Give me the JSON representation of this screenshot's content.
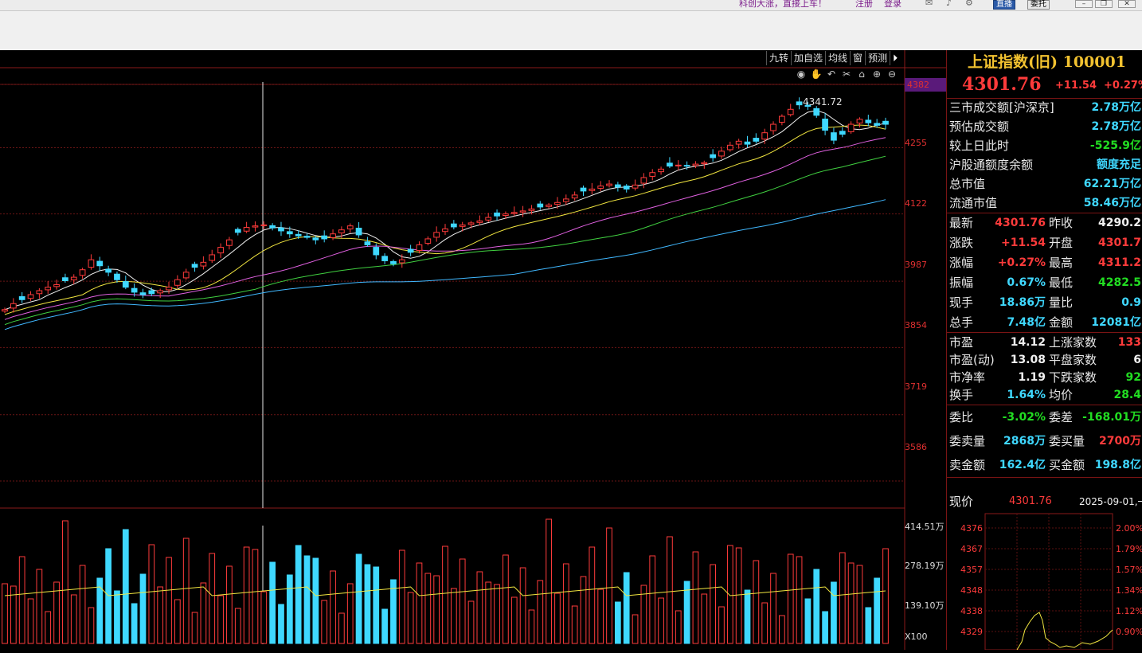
{
  "topbar": {
    "promo": "科创大涨，直接上车！",
    "register": "注册",
    "login": "登录",
    "icons": [
      "mail-icon",
      "bell-icon",
      "settings-icon"
    ],
    "btn_live": "直播",
    "btn_order": "委托"
  },
  "toolbar_buttons": [
    "九转",
    "加自选",
    "均线",
    "窗",
    "预测"
  ],
  "chart": {
    "price_axis": [
      "4382",
      "4255",
      "4122",
      "3987",
      "3854",
      "3719",
      "3586"
    ],
    "high_label": "4341.72",
    "volume_axis": [
      "414.51万",
      "278.19万",
      "139.10万"
    ],
    "volume_unit": "X100"
  },
  "chart_data": {
    "type": "candlestick",
    "price_axis_ticks": [
      4382,
      4255,
      4122,
      3987,
      3854,
      3719,
      3586
    ],
    "ylim": [
      3500,
      4400
    ],
    "high": 4341.72,
    "volume_axis_ticks_wan": [
      414.51,
      278.19,
      139.1
    ],
    "closes": [
      3930,
      3942,
      3950,
      3960,
      3968,
      3975,
      3980,
      3988,
      3995,
      4010,
      4030,
      4018,
      4005,
      3990,
      3975,
      3965,
      3960,
      3962,
      3968,
      3975,
      3990,
      4005,
      4015,
      4025,
      4040,
      4055,
      4070,
      4085,
      4095,
      4098,
      4100,
      4094,
      4088,
      4082,
      4078,
      4075,
      4070,
      4072,
      4082,
      4090,
      4098,
      4080,
      4060,
      4040,
      4028,
      4022,
      4030,
      4045,
      4060,
      4072,
      4085,
      4092,
      4096,
      4100,
      4104,
      4108,
      4115,
      4118,
      4122,
      4125,
      4128,
      4132,
      4136,
      4140,
      4145,
      4152,
      4160,
      4168,
      4172,
      4178,
      4182,
      4176,
      4172,
      4180,
      4195,
      4205,
      4212,
      4218,
      4220,
      4218,
      4222,
      4225,
      4235,
      4248,
      4260,
      4268,
      4262,
      4268,
      4285,
      4302,
      4318,
      4332,
      4341,
      4338,
      4320,
      4290,
      4270,
      4282,
      4302,
      4312,
      4305,
      4300,
      4302
    ]
  },
  "panel": {
    "title": "上证指数(旧) 100001",
    "price": "4301.76",
    "change": "+11.54",
    "pct": "+0.27%",
    "block1": [
      {
        "label": "三市成交额[沪深京]",
        "value": "2.78万亿",
        "color": "cyan"
      },
      {
        "label": "预估成交额",
        "value": "2.78万亿",
        "color": "cyan"
      },
      {
        "label": "较上日此时",
        "value": "-525.9亿",
        "color": "grn"
      },
      {
        "label": "沪股通额度余额",
        "value": "额度充足",
        "color": "cyan"
      },
      {
        "label": "总市值",
        "value": "62.21万亿",
        "color": "cyan"
      },
      {
        "label": "流通市值",
        "value": "58.46万亿",
        "color": "cyan"
      }
    ],
    "block2": [
      {
        "l1": "最新",
        "v1": "4301.76",
        "c1": "red",
        "l2": "昨收",
        "v2": "4290.2",
        "c2": "wht"
      },
      {
        "l1": "涨跌",
        "v1": "+11.54",
        "c1": "red",
        "l2": "开盘",
        "v2": "4301.7",
        "c2": "red"
      },
      {
        "l1": "涨幅",
        "v1": "+0.27%",
        "c1": "red",
        "l2": "最高",
        "v2": "4311.2",
        "c2": "red"
      },
      {
        "l1": "振幅",
        "v1": "0.67%",
        "c1": "cyan",
        "l2": "最低",
        "v2": "4282.5",
        "c2": "grn"
      },
      {
        "l1": "现手",
        "v1": "18.86万",
        "c1": "cyan",
        "l2": "量比",
        "v2": "0.9",
        "c2": "cyan"
      },
      {
        "l1": "总手",
        "v1": "7.48亿",
        "c1": "cyan",
        "l2": "金额",
        "v2": "12081亿",
        "c2": "cyan"
      }
    ],
    "block3": [
      {
        "l1": "市盈",
        "v1": "14.12",
        "c1": "wht",
        "l2": "上涨家数",
        "v2": "133",
        "c2": "red"
      },
      {
        "l1": "市盈(动)",
        "v1": "13.08",
        "c1": "wht",
        "l2": "平盘家数",
        "v2": "6",
        "c2": "wht"
      },
      {
        "l1": "市净率",
        "v1": "1.19",
        "c1": "wht",
        "l2": "下跌家数",
        "v2": "92",
        "c2": "grn"
      },
      {
        "l1": "换手",
        "v1": "1.64%",
        "c1": "cyan",
        "l2": "均价",
        "v2": "28.4",
        "c2": "grn"
      }
    ],
    "block4": [
      {
        "l1": "委比",
        "v1": "-3.02%",
        "c1": "grn",
        "l2": "委差",
        "v2": "-168.01万",
        "c2": "grn"
      },
      {
        "l1": "委卖量",
        "v1": "2868万",
        "c1": "cyan",
        "l2": "委买量",
        "v2": "2700万",
        "c2": "red"
      },
      {
        "l1": "卖金额",
        "v1": "162.4亿",
        "c1": "cyan",
        "l2": "买金额",
        "v2": "198.8亿",
        "c2": "cyan"
      }
    ],
    "now_label": "现价",
    "now_value": "4301.76",
    "now_date": "2025-09-01,一",
    "mini_left": [
      "4376",
      "4367",
      "4357",
      "4348",
      "4338",
      "4329"
    ],
    "mini_right": [
      "2.00%",
      "1.79%",
      "1.57%",
      "1.34%",
      "1.12%",
      "0.90%"
    ]
  }
}
